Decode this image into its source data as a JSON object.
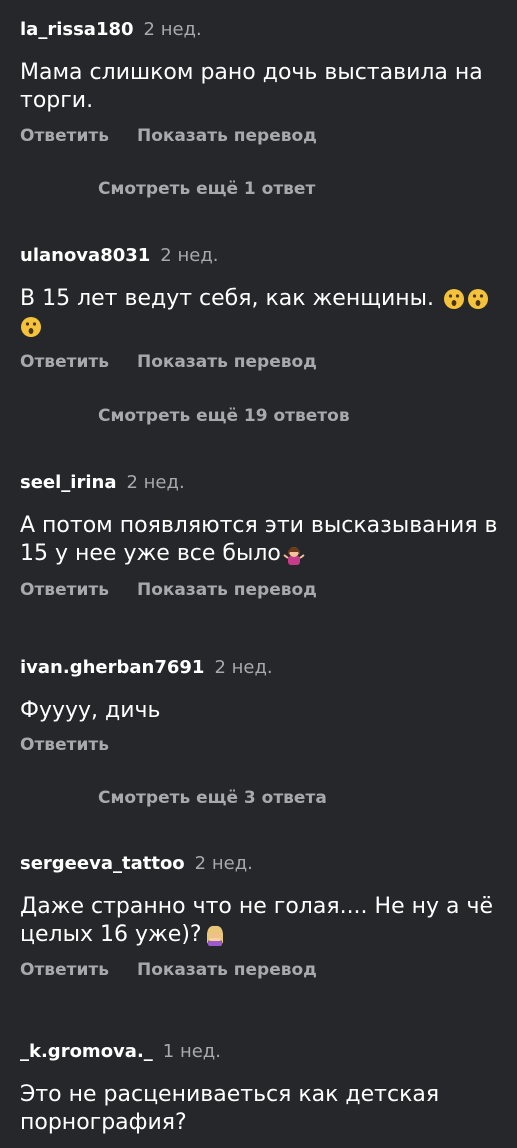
{
  "comments": [
    {
      "username": "la_rissa180",
      "time": "2 нед.",
      "text": "Мама слишком рано дочь выставила на торги.",
      "reply": "Ответить",
      "translate": "Показать перевод",
      "more": "Смотреть ещё 1 ответ"
    },
    {
      "username": "ulanova8031",
      "time": "2 нед.",
      "text": "В 15 лет ведут себя, как женщины.",
      "reply": "Ответить",
      "translate": "Показать перевод",
      "more": "Смотреть ещё 19 ответов",
      "emojis": [
        "astonished-face",
        "astonished-face",
        "astonished-face"
      ]
    },
    {
      "username": "seel_irina",
      "time": "2 нед.",
      "text": "А потом появляются эти высказывания в 15 у нее уже все было",
      "reply": "Ответить",
      "translate": "Показать перевод",
      "emojis": [
        "woman-shrugging"
      ]
    },
    {
      "username": "ivan.gherban7691",
      "time": "2 нед.",
      "text": "Фуууу, дичь",
      "reply": "Ответить",
      "more": "Смотреть ещё 3 ответа"
    },
    {
      "username": "sergeeva_tattoo",
      "time": "2 нед.",
      "text": "Даже странно что не голая.... Не ну а чё целых 16 уже)?",
      "reply": "Ответить",
      "translate": "Показать перевод",
      "emojis": [
        "woman-facepalming"
      ]
    },
    {
      "username": "_k.gromova._",
      "time": "1 нед.",
      "text": "Это не расцениваеться как детская порнография?"
    }
  ],
  "colors": {
    "background": "#25272b",
    "text": "#ffffff",
    "muted": "#a7a9ad"
  }
}
